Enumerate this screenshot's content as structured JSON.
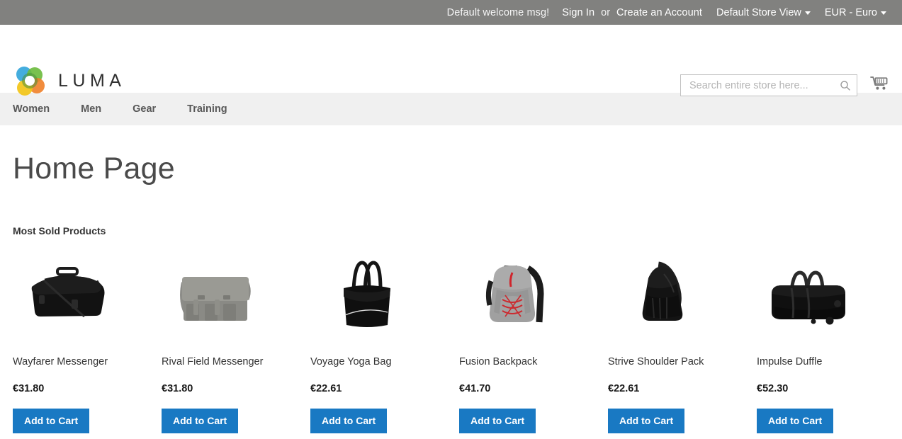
{
  "top_panel": {
    "greeting": "Default welcome msg!",
    "sign_in": "Sign In",
    "or": "or",
    "create_account": "Create an Account",
    "store_view": "Default Store View",
    "currency": "EUR - Euro"
  },
  "header": {
    "logo_text": "LUMA",
    "logo_icon": "luma-flower-logo",
    "search_placeholder": "Search entire store here...",
    "search_value": "",
    "search_icon": "search-icon",
    "cart_icon": "shopping-cart-icon"
  },
  "nav": {
    "items": [
      {
        "label": "Women"
      },
      {
        "label": "Men"
      },
      {
        "label": "Gear"
      },
      {
        "label": "Training"
      }
    ]
  },
  "main": {
    "page_title": "Home Page",
    "section_title": "Most Sold Products",
    "add_to_cart_label": "Add to Cart",
    "accent_color": "#1979c3",
    "products": [
      {
        "name": "Wayfarer Messenger",
        "price": "€31.80",
        "image": "black-messenger-bag"
      },
      {
        "name": "Rival Field Messenger",
        "price": "€31.80",
        "image": "gray-canvas-messenger-bag"
      },
      {
        "name": "Voyage Yoga Bag",
        "price": "€22.61",
        "image": "black-tote-yoga-bag"
      },
      {
        "name": "Fusion Backpack",
        "price": "€41.70",
        "image": "gray-red-backpack"
      },
      {
        "name": "Strive Shoulder Pack",
        "price": "€22.61",
        "image": "black-sling-shoulder-pack"
      },
      {
        "name": "Impulse Duffle",
        "price": "€52.30",
        "image": "black-wheeled-duffle-bag"
      }
    ]
  }
}
